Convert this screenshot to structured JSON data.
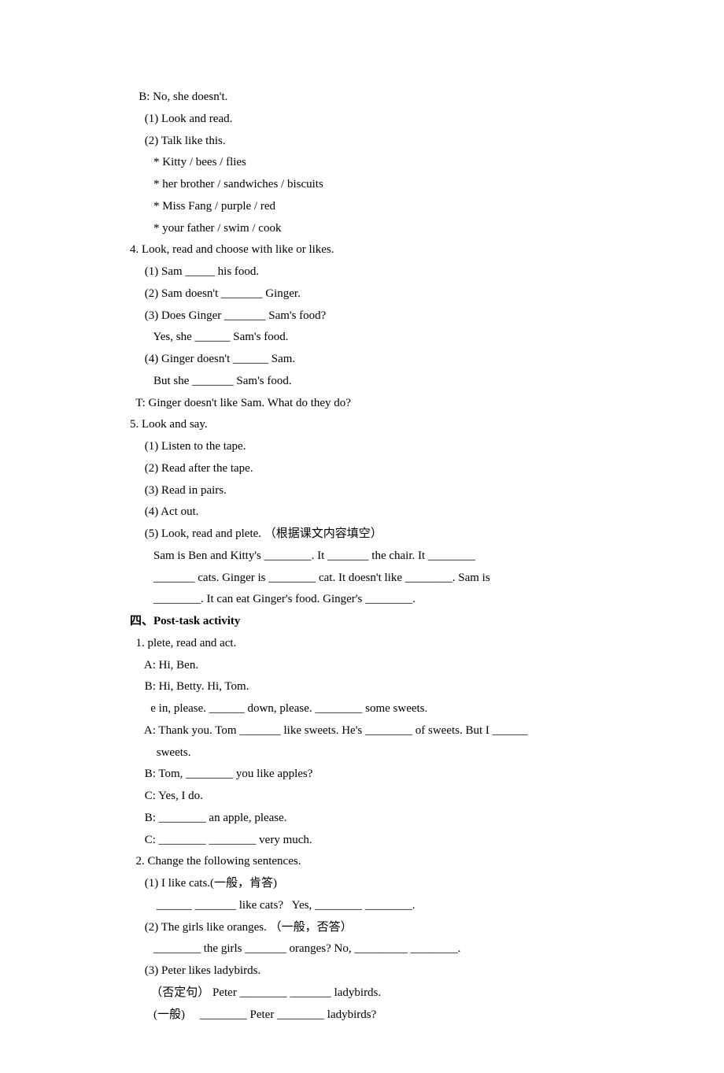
{
  "lines": {
    "b_answer": "   B: No, she doesn't.",
    "look_read": "     (1) Look and read.",
    "talk_like": "     (2) Talk like this.",
    "star1": "        * Kitty / bees / flies",
    "star2": "        * her brother / sandwiches / biscuits",
    "star3": "        * Miss Fang / purple / red",
    "star4": "        * your father / swim / cook",
    "item4": "4. Look, read and choose with like or likes.",
    "i4_1": "     (1) Sam _____ his food.",
    "i4_2": "     (2) Sam doesn't _______ Ginger.",
    "i4_3": "     (3) Does Ginger _______ Sam's food?",
    "i4_3b": "        Yes, she ______ Sam's food.",
    "i4_4": "     (4) Ginger doesn't ______ Sam.",
    "i4_4b": "        But she _______ Sam's food.",
    "teacher": "  T: Ginger doesn't like Sam. What do they do?",
    "item5": "5. Look and say.",
    "i5_1": "     (1) Listen to the tape.",
    "i5_2": "     (2) Read after the tape.",
    "i5_3": "     (3) Read in pairs.",
    "i5_4": "     (4) Act out.",
    "i5_5": "     (5) Look, read and plete. （根据课文内容填空）",
    "i5_5a": "        Sam is Ben and Kitty's ________. It _______ the chair. It ________",
    "i5_5b": "        _______ cats. Ginger is ________ cat. It doesn't like ________. Sam is",
    "i5_5c": "        ________. It can eat Ginger's food. Ginger's ________.",
    "sec4_title": "四、Post-task activity",
    "s4_1": "  1. plete, read and act.",
    "s4_1a": "     A: Hi, Ben.",
    "s4_1b": "     B: Hi, Betty. Hi, Tom.",
    "s4_1b2": "       e in, please. ______ down, please. ________ some sweets.",
    "s4_1a2": "     A: Thank you. Tom _______ like sweets. He's ________ of sweets. But I ______",
    "s4_1a2b": "         sweets.",
    "s4_1b3": "     B: Tom, ________ you like apples?",
    "s4_1c": "     C: Yes, I do.",
    "s4_1b4": "     B: ________ an apple, please.",
    "s4_1c2": "     C: ________ ________ very much.",
    "s4_2": "  2. Change the following sentences.",
    "s4_2_1": "     (1) I like cats.(一般，肯答)",
    "s4_2_1b": "         ______ _______ like cats?   Yes, ________ ________.",
    "s4_2_2": "     (2) The girls like oranges. （一般，否答）",
    "s4_2_2b": "        ________ the girls _______ oranges? No, _________ ________.",
    "s4_2_3": "     (3) Peter likes ladybirds.",
    "s4_2_3b": "       （否定句） Peter ________ _______ ladybirds.",
    "s4_2_3c": "        (一般)     ________ Peter ________ ladybirds?"
  }
}
